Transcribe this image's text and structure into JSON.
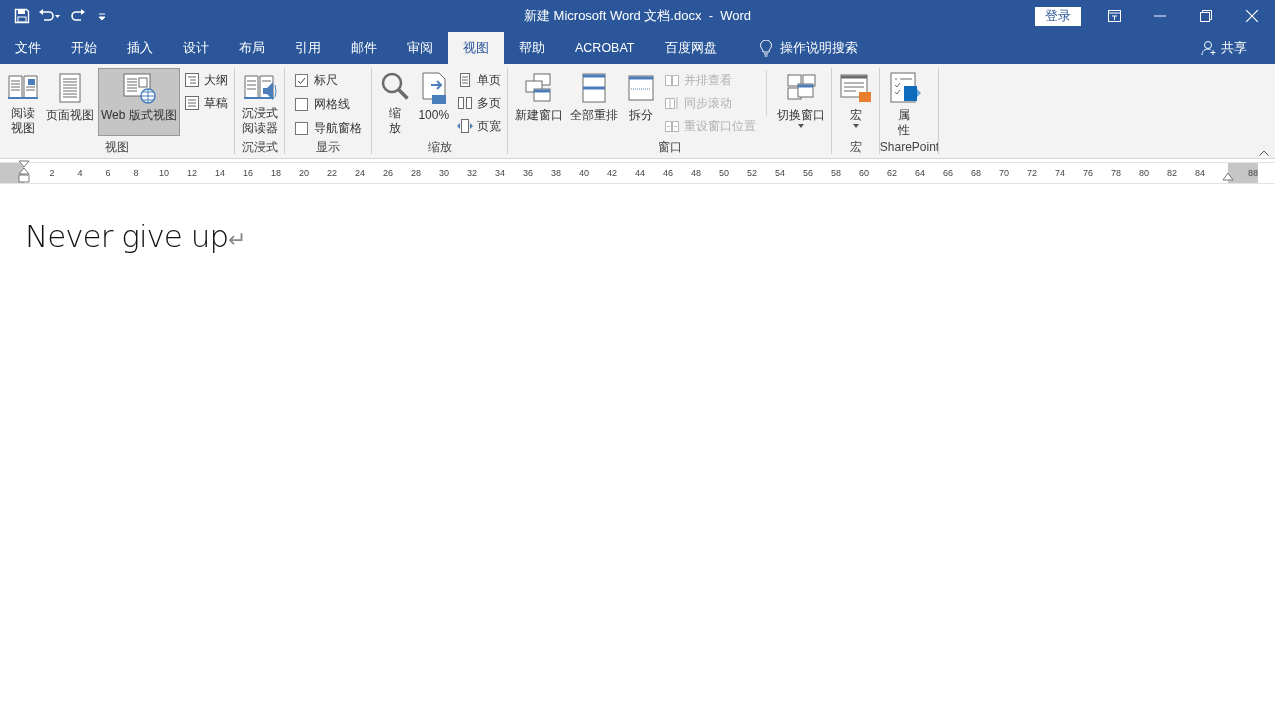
{
  "title_bar": {
    "title": "新建 Microsoft Word 文档.docx  -  Word",
    "login_button": "登录"
  },
  "tabs": [
    {
      "label": "文件",
      "selected": false
    },
    {
      "label": "开始",
      "selected": false
    },
    {
      "label": "插入",
      "selected": false
    },
    {
      "label": "设计",
      "selected": false
    },
    {
      "label": "布局",
      "selected": false
    },
    {
      "label": "引用",
      "selected": false
    },
    {
      "label": "邮件",
      "selected": false
    },
    {
      "label": "审阅",
      "selected": false
    },
    {
      "label": "视图",
      "selected": true
    },
    {
      "label": "帮助",
      "selected": false
    },
    {
      "label": "ACROBAT",
      "selected": false
    },
    {
      "label": "百度网盘",
      "selected": false
    }
  ],
  "tell_me": "操作说明搜索",
  "share": "共享",
  "ribbon": {
    "groups": [
      {
        "label": "视图",
        "items": [
          {
            "kind": "large",
            "label": [
              "阅读",
              "视图"
            ],
            "selected": false
          },
          {
            "kind": "large",
            "label": [
              "页面视图"
            ],
            "selected": false
          },
          {
            "kind": "large",
            "label": [
              "Web 版式视图"
            ],
            "selected": true
          },
          {
            "kind": "stack",
            "items": [
              {
                "kind": "small",
                "label": "大纲",
                "disabled": false
              },
              {
                "kind": "small",
                "label": "草稿",
                "disabled": false
              }
            ]
          }
        ]
      },
      {
        "label": "沉浸式",
        "items": [
          {
            "kind": "large",
            "label": [
              "沉浸式",
              "阅读器"
            ]
          }
        ]
      },
      {
        "label": "显示",
        "items": [
          {
            "kind": "stack",
            "items": [
              {
                "kind": "checkbox",
                "label": "标尺",
                "checked": true
              },
              {
                "kind": "checkbox",
                "label": "网格线",
                "checked": false
              },
              {
                "kind": "checkbox",
                "label": "导航窗格",
                "checked": false
              }
            ]
          }
        ]
      },
      {
        "label": "缩放",
        "items": [
          {
            "kind": "large",
            "label": [
              "缩",
              "放"
            ]
          },
          {
            "kind": "large",
            "label": [
              "100%"
            ]
          },
          {
            "kind": "stack",
            "items": [
              {
                "kind": "small",
                "label": "单页",
                "disabled": false
              },
              {
                "kind": "small",
                "label": "多页",
                "disabled": false
              },
              {
                "kind": "small",
                "label": "页宽",
                "disabled": false
              }
            ]
          }
        ]
      },
      {
        "label": "窗口",
        "items": [
          {
            "kind": "large",
            "label": [
              "新建窗口"
            ]
          },
          {
            "kind": "large",
            "label": [
              "全部重排"
            ]
          },
          {
            "kind": "large",
            "label": [
              "拆分"
            ]
          },
          {
            "kind": "stack",
            "items": [
              {
                "kind": "small",
                "label": "并排查看",
                "disabled": true
              },
              {
                "kind": "small",
                "label": "同步滚动",
                "disabled": true
              },
              {
                "kind": "small",
                "label": "重设窗口位置",
                "disabled": true
              }
            ]
          },
          {
            "kind": "large",
            "label": [
              "切换窗口"
            ],
            "dropdown": true
          }
        ]
      },
      {
        "label": "宏",
        "items": [
          {
            "kind": "large",
            "label": [
              "宏"
            ],
            "dropdown": true
          }
        ]
      },
      {
        "label": "SharePoint",
        "items": [
          {
            "kind": "large",
            "label": [
              "属",
              "性"
            ]
          }
        ]
      }
    ]
  },
  "ruler": {
    "numbers": [
      "2",
      "4",
      "6",
      "8",
      "10",
      "12",
      "14",
      "16",
      "18",
      "20",
      "22",
      "24",
      "26",
      "28",
      "30",
      "32",
      "34",
      "36",
      "38",
      "40",
      "42",
      "44",
      "46",
      "48",
      "50",
      "52",
      "54",
      "56",
      "58",
      "60",
      "62",
      "64",
      "66",
      "68",
      "70",
      "72",
      "74",
      "76",
      "78",
      "80",
      "82",
      "84"
    ],
    "end_number": "88"
  },
  "document": {
    "text": "Never give up",
    "paragraph_mark": "↵"
  }
}
